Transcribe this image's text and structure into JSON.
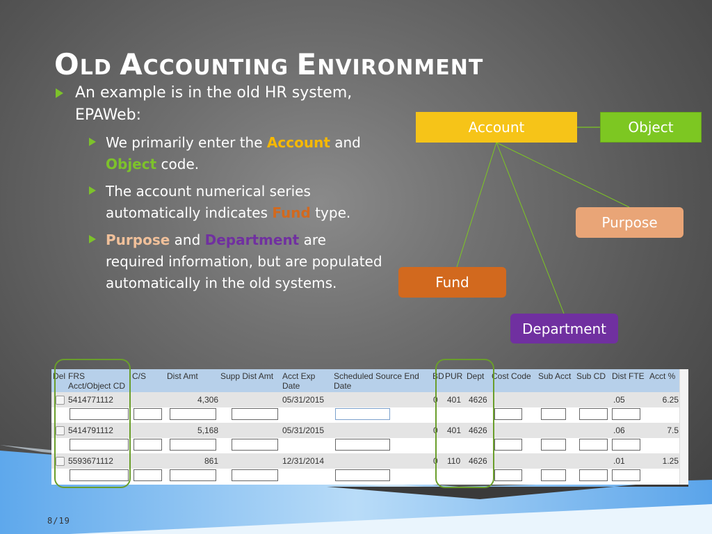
{
  "slide": {
    "title_parts": [
      {
        "cap": "O",
        "rest": "LD "
      },
      {
        "cap": "A",
        "rest": "CCOUNTING "
      },
      {
        "cap": "E",
        "rest": "NVIRONMENT"
      }
    ],
    "bullet_main_line1": "An example is in the old HR system,",
    "bullet_main_line2": "EPAWeb:",
    "sub1": {
      "pre": "We primarily enter the ",
      "hl1": "Account",
      "mid": " and",
      "hl2": "Object",
      "post": " code."
    },
    "sub2": {
      "line1": "The account numerical series",
      "pre": "automatically indicates ",
      "hl": "Fund",
      "post": " type."
    },
    "sub3": {
      "hl1": "Purpose",
      "mid": " and ",
      "hl2": "Department",
      "post": " are",
      "line2": "required information, but are populated",
      "line3": "automatically in the old systems."
    },
    "page_number": "8/19"
  },
  "colors": {
    "account": "#f6c418",
    "object": "#7dc722",
    "purpose": "#e9a577",
    "fund": "#d2691e",
    "department": "#7030a0",
    "arrow": "#7dc22b",
    "highlight_border": "#6a9e2b"
  },
  "diagram": {
    "account": "Account",
    "object": "Object",
    "purpose": "Purpose",
    "fund": "Fund",
    "department": "Department"
  },
  "table": {
    "headers": {
      "del": "Del",
      "frs": "FRS",
      "frs2": "Acct/Object CD",
      "cs": "C/S",
      "dist_amt": "Dist Amt",
      "supp": "Supp Dist Amt",
      "acct_exp": "Acct Exp",
      "acct_exp2": "Date",
      "sched": "Scheduled Source End",
      "sched2": "Date",
      "bd": "BD",
      "pur": "PUR",
      "dept": "Dept",
      "cost": "Cost Code",
      "sub_acct": "Sub Acct",
      "sub_cd": "Sub CD",
      "fte": "Dist FTE",
      "pct": "Acct %"
    },
    "rows": [
      {
        "frs": "5414771112",
        "dist_amt": "4,306",
        "acct_exp": "05/31/2015",
        "bd": "0",
        "pur": "401",
        "dept": "4626",
        "fte": ".05",
        "pct": "6.25"
      },
      {
        "frs": "5414791112",
        "dist_amt": "5,168",
        "acct_exp": "05/31/2015",
        "bd": "0",
        "pur": "401",
        "dept": "4626",
        "fte": ".06",
        "pct": "7.5"
      },
      {
        "frs": "5593671112",
        "dist_amt": "861",
        "acct_exp": "12/31/2014",
        "bd": "0",
        "pur": "110",
        "dept": "4626",
        "fte": ".01",
        "pct": "1.25"
      }
    ]
  }
}
